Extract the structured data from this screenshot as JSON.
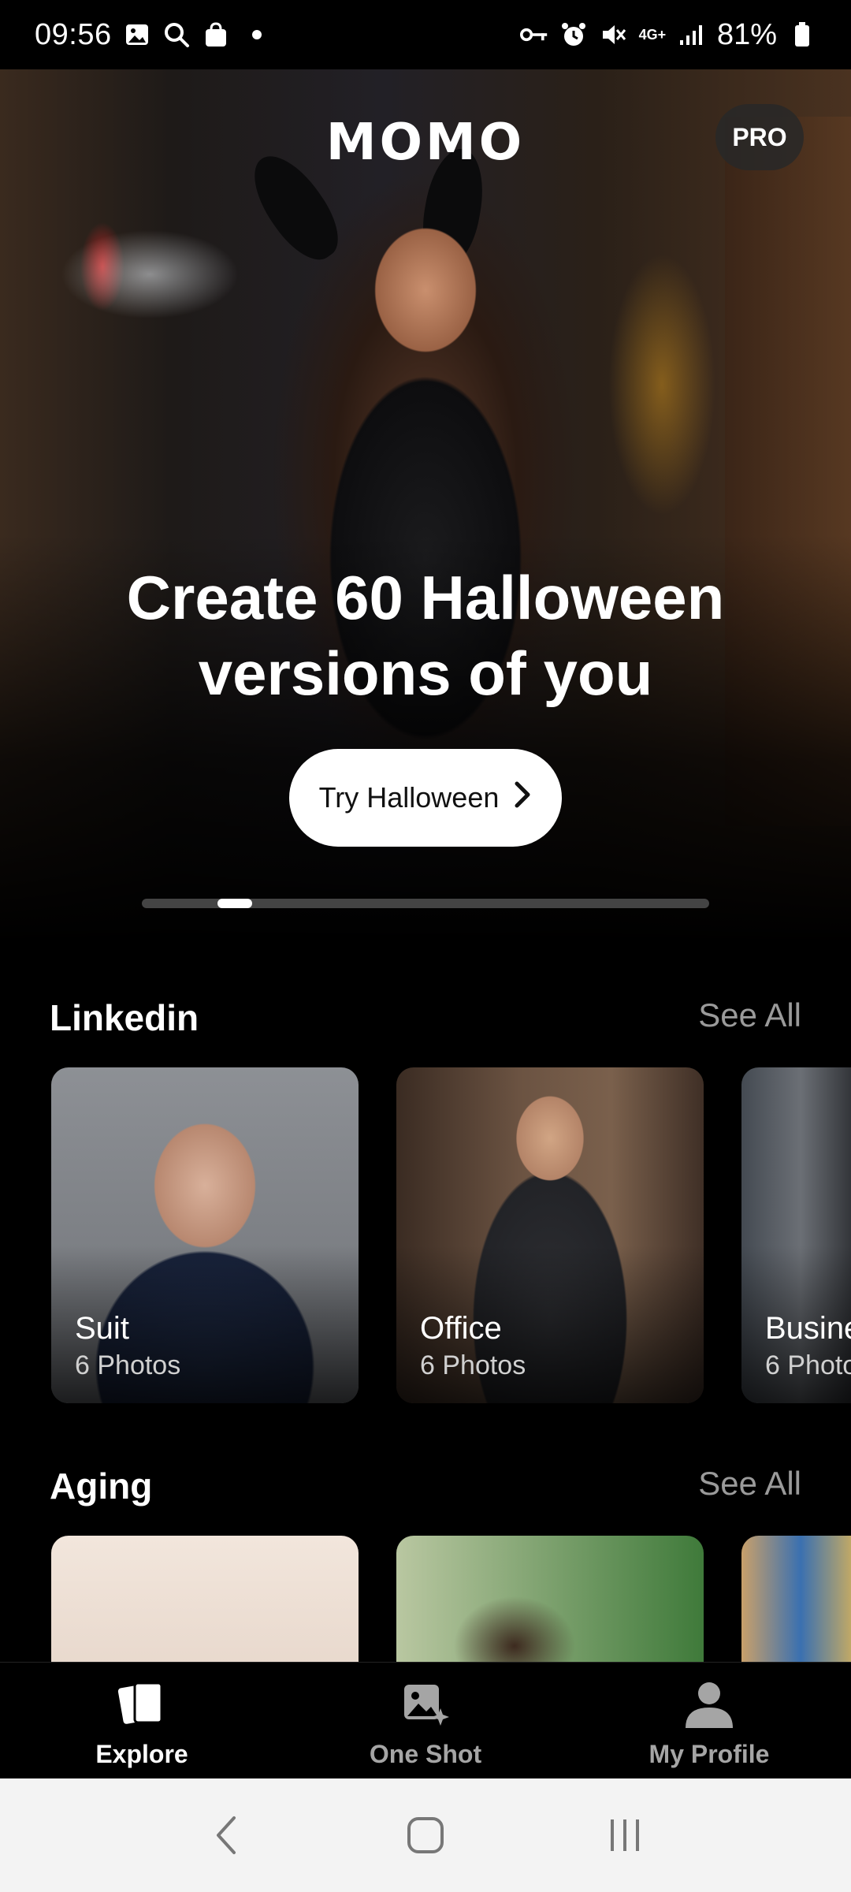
{
  "status_bar": {
    "time": "09:56",
    "battery": "81%",
    "network": "4G+",
    "left_icons": [
      "gallery-icon",
      "search-icon",
      "shopping-bag-icon",
      "notification-dot"
    ],
    "right_icons": [
      "vpn-key-icon",
      "alarm-icon",
      "mute-icon",
      "network-4g-icon",
      "signal-icon",
      "battery-icon"
    ]
  },
  "header": {
    "logo": "MOMO",
    "pro_label": "PRO"
  },
  "hero": {
    "title_line1": "Create 60 Halloween",
    "title_line2": "versions of you",
    "cta_label": "Try Halloween",
    "carousel_position": 0.2
  },
  "sections": [
    {
      "title": "Linkedin",
      "see_all": "See All",
      "cards": [
        {
          "title": "Suit",
          "subtitle": "6 Photos"
        },
        {
          "title": "Office",
          "subtitle": "6 Photos"
        },
        {
          "title": "Busine",
          "subtitle": "6 Photo"
        }
      ]
    },
    {
      "title": "Aging",
      "see_all": "See All",
      "cards": [
        {
          "title": "",
          "subtitle": ""
        },
        {
          "title": "",
          "subtitle": ""
        },
        {
          "title": "",
          "subtitle": ""
        }
      ]
    }
  ],
  "bottom_nav": {
    "items": [
      {
        "label": "Explore",
        "icon": "cards-icon",
        "active": true
      },
      {
        "label": "One Shot",
        "icon": "photo-sparkle-icon",
        "active": false
      },
      {
        "label": "My Profile",
        "icon": "person-icon",
        "active": false
      }
    ]
  },
  "system_nav": [
    "back-icon",
    "home-icon",
    "recents-icon"
  ],
  "colors": {
    "background": "#000000",
    "accent": "#ffffff",
    "muted_text": "#9a9a9a",
    "system_nav_bg": "#f3f3f3"
  }
}
